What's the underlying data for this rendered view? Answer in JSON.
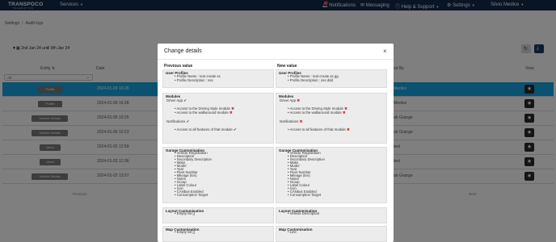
{
  "nav": {
    "brand": "TRANSPOCO",
    "brand_sub": "TELEMATICS",
    "services": "Services",
    "notifications": "Notifications",
    "messaging": "Messaging",
    "help": "Help & Support",
    "settings": "Settings",
    "user": "Silvio Medice"
  },
  "breadcrumb": {
    "item1": "Settings",
    "item2": "Audit logs"
  },
  "filter": {
    "date_range": "2nd Jan 24 until 9th Jan 24"
  },
  "table": {
    "headers": {
      "entity": "Entity",
      "date": "Date",
      "changed_by": "ed By",
      "view": "View"
    },
    "entity_filter_value": "All",
    "rows": [
      {
        "entity": "Profile",
        "date": "2024-01-09 16:28",
        "by": "Medice"
      },
      {
        "entity": "Profile",
        "date": "2024-01-09 16:28",
        "by": "Medice"
      },
      {
        "entity": "Vehicle Details",
        "date": "2024-01-05 10:25",
        "by": "ah Grange"
      },
      {
        "entity": "Vehicle Details",
        "date": "2024-01-05 10:23",
        "by": "ah Grange"
      },
      {
        "entity": "Users",
        "date": "2024-01-02 12:59",
        "by": "test"
      },
      {
        "entity": "Users",
        "date": "2024-01-02 12:36",
        "by": "test"
      },
      {
        "entity": "Vehicle Details",
        "date": "2024-01-02 13:57",
        "by": "ah Grange"
      }
    ],
    "prev": "Previous",
    "next": "Next"
  },
  "modal": {
    "title": "Change details",
    "close": "×",
    "previous_title": "Previous value",
    "new_title": "New value",
    "previous": {
      "user_profiles": {
        "title": "User Profiles",
        "name": "Profile Name : test create ss",
        "desc": "Profile Description : sss"
      },
      "modules": {
        "title": "Modules",
        "driver_app": "Driver App",
        "d1": "Access to the Driving Style module",
        "d2": "Access to the walkaround module",
        "notifications": "Notifications",
        "n1": "Access to all features of that module"
      },
      "garage": {
        "title": "Garage Customisation",
        "items": [
          "Vehicle Registration",
          "Description",
          "Secondary Description",
          "Make",
          "Model",
          "Year",
          "Fleet Number",
          "Mileage (km)",
          "Notes",
          "Group",
          "Label Colour",
          "Icon",
          "CANbus Enabled",
          "Consumption Target"
        ]
      },
      "layout": {
        "title": "Layout Customisation",
        "item": "Empty list []"
      },
      "map": {
        "title": "Map Customisation",
        "item": "Empty list []"
      }
    },
    "next_value": {
      "user_profiles": {
        "title": "User Profiles",
        "name": "Profile Name : test create ss gg",
        "desc": "Profile Description : sss ddd"
      },
      "modules": {
        "title": "Modules",
        "driver_app": "Driver App",
        "d1": "Access to the Driving Style module",
        "d2": "Access to the walkaround module",
        "notifications": "Notifications",
        "n1": "Access to all features of that module"
      },
      "garage": {
        "title": "Garage Customisation",
        "items": [
          "Vehicle Registration",
          "Description",
          "Secondary Description",
          "Make",
          "Model",
          "Year",
          "Fleet Number",
          "Mileage (km)",
          "Notes",
          "Group",
          "Label Colour",
          "Icon",
          "CANbus Enabled",
          "Consumption Target"
        ]
      },
      "layout": {
        "title": "Layout Customisation",
        "item": "Vehicle Description"
      },
      "map": {
        "title": "Map Customisation",
        "item": "Line"
      }
    }
  },
  "colors": {
    "navbar": "#12294a",
    "highlight_row": "#17a2e0",
    "badge": "#e53935",
    "check": "#2e7d32",
    "cross": "#d32f2f"
  }
}
